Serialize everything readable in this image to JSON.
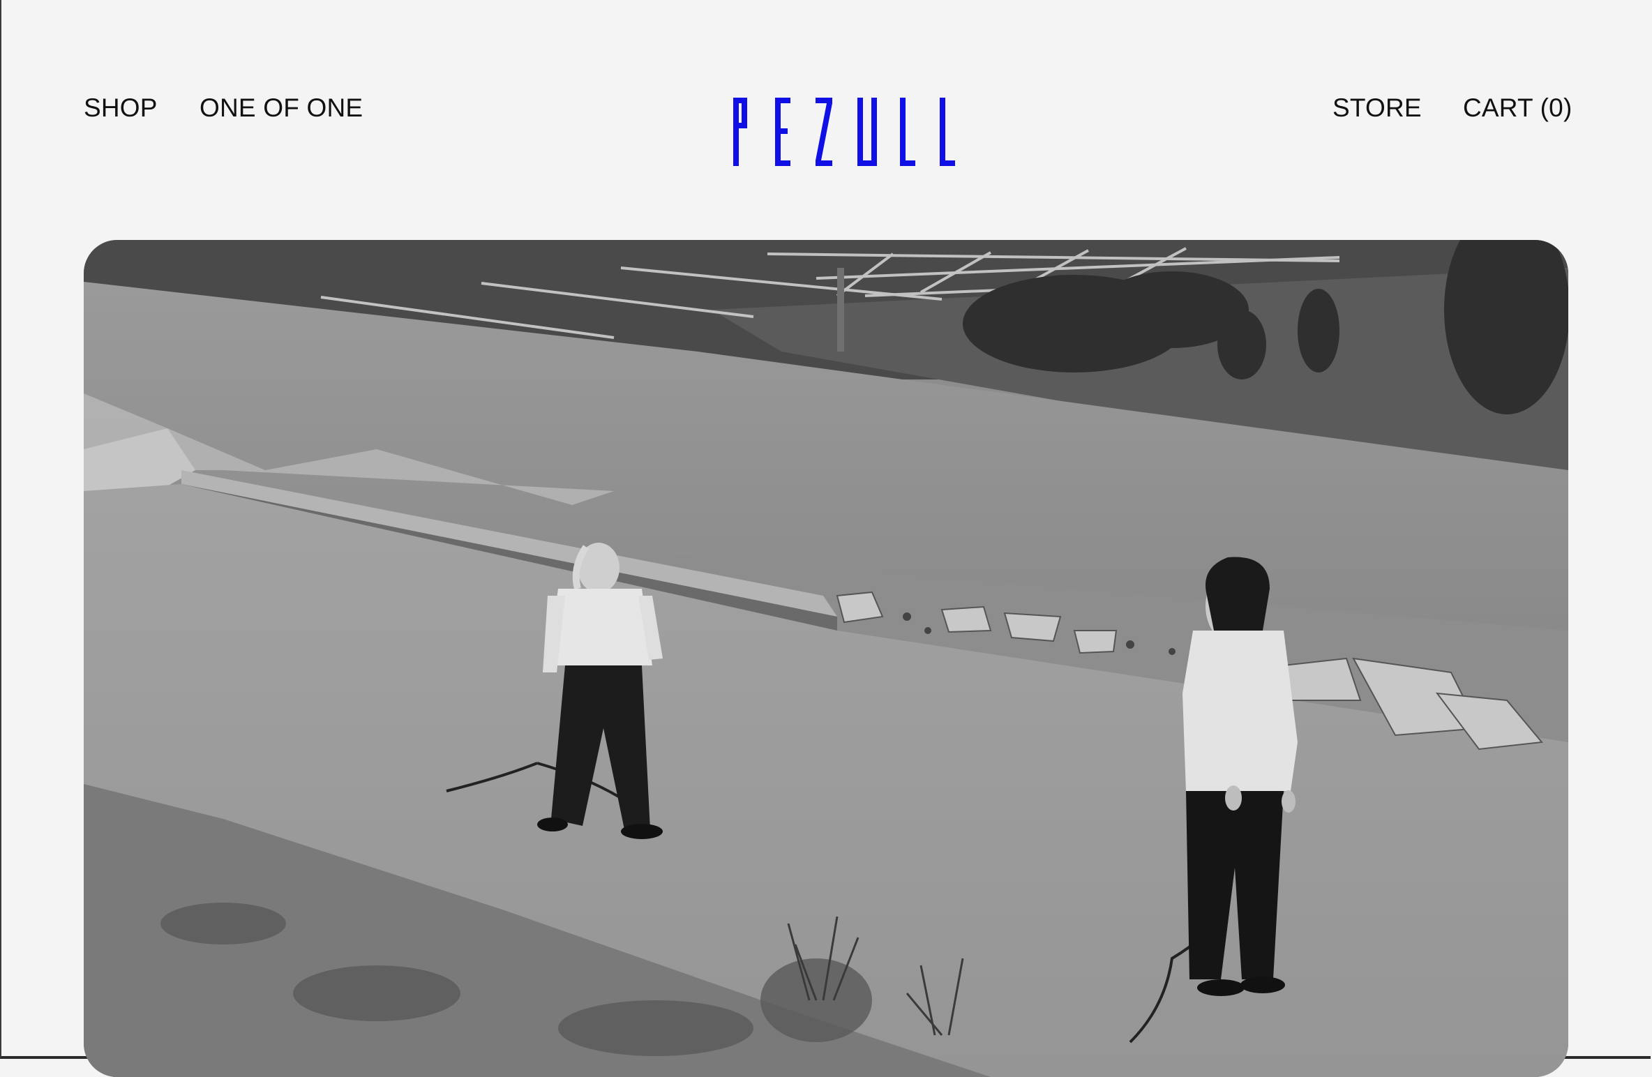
{
  "header": {
    "nav_left": [
      {
        "label": "SHOP"
      },
      {
        "label": "ONE OF ONE"
      }
    ],
    "logo_text": "PEZULL",
    "nav_right": [
      {
        "label": "STORE"
      },
      {
        "label": "CART (0)"
      }
    ]
  },
  "colors": {
    "background": "#f3f4f3",
    "text": "#111111",
    "logo": "#1010e6"
  },
  "hero": {
    "image": "black-and-white-photo-two-people-standing-on-cracked-concrete-lot"
  }
}
